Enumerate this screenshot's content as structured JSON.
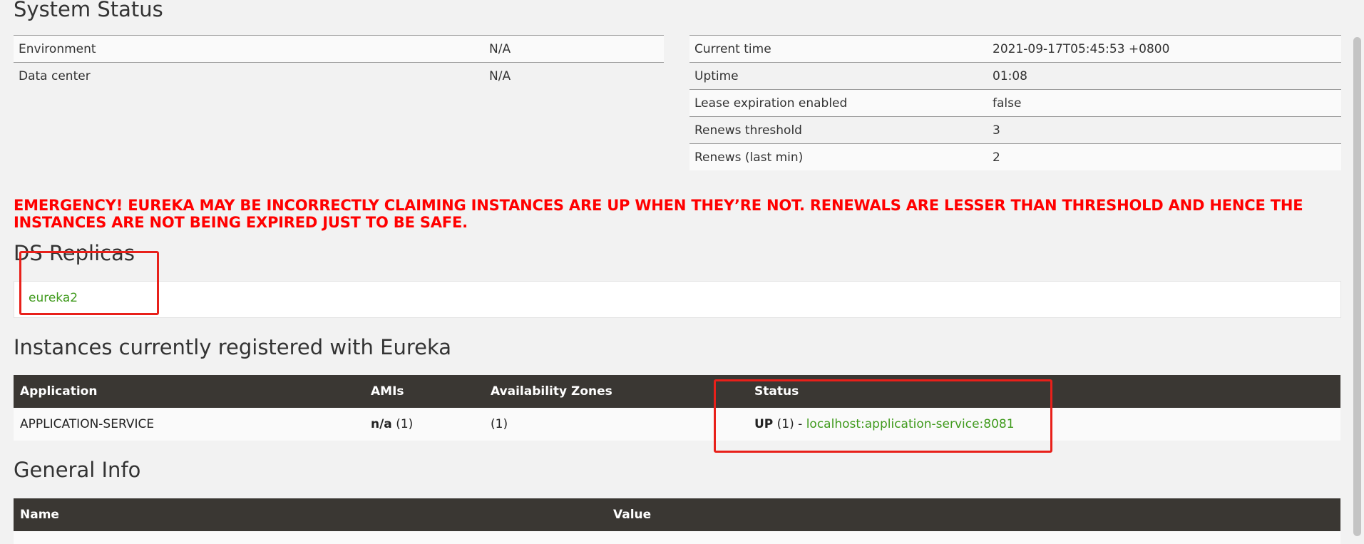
{
  "system_status": {
    "title": "System Status",
    "left_table": [
      {
        "key": "Environment",
        "value": "N/A"
      },
      {
        "key": "Data center",
        "value": "N/A"
      }
    ],
    "right_table": [
      {
        "key": "Current time",
        "value": "2021-09-17T05:45:53 +0800"
      },
      {
        "key": "Uptime",
        "value": "01:08"
      },
      {
        "key": "Lease expiration enabled",
        "value": "false"
      },
      {
        "key": "Renews threshold",
        "value": "3"
      },
      {
        "key": "Renews (last min)",
        "value": "2"
      }
    ]
  },
  "emergency": {
    "line1": "EMERGENCY! EUREKA MAY BE INCORRECTLY CLAIMING INSTANCES ARE UP WHEN THEY’RE NOT. RENEWALS ARE LESSER THAN THRESHOLD AND HENCE THE",
    "line2": "INSTANCES ARE NOT BEING EXPIRED JUST TO BE SAFE.",
    "color": "#ff0000"
  },
  "ds_replicas": {
    "title": "DS Replicas",
    "items": [
      "eureka2"
    ]
  },
  "instances": {
    "title": "Instances currently registered with Eureka",
    "headers": [
      "Application",
      "AMIs",
      "Availability Zones",
      "Status"
    ],
    "rows": [
      {
        "application": "APPLICATION-SERVICE",
        "amis_bold": "n/a",
        "amis_count": "(1)",
        "zones": "(1)",
        "status_bold": "UP",
        "status_count": "(1) -",
        "status_link": "localhost:application-service:8081"
      }
    ]
  },
  "general_info": {
    "title": "General Info",
    "headers": [
      "Name",
      "Value"
    ]
  },
  "colors": {
    "link_green": "#3f9a1c",
    "header_dark": "#3a3733",
    "annotation_red": "#e8201a"
  }
}
